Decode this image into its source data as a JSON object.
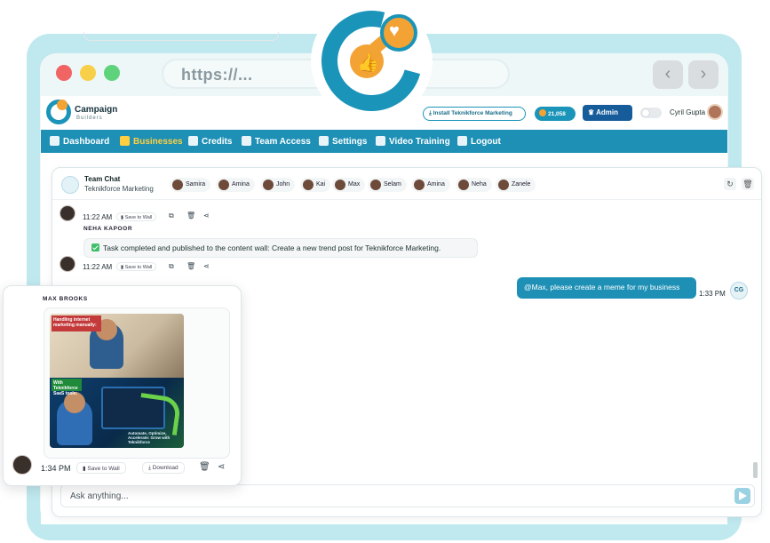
{
  "browser": {
    "url": "https://...",
    "back": "‹",
    "forward": "›"
  },
  "header": {
    "logo_line1": "Campaign",
    "logo_line2": "Builders",
    "install_label": "Install Teknikforce Marketing",
    "credits_value": "21,058",
    "admin_label": "Admin",
    "user_name": "Cyril Gupta"
  },
  "menu": [
    {
      "label": "Dashboard",
      "icon": "grid-icon"
    },
    {
      "label": "Businesses",
      "icon": "megaphone-icon",
      "active": true
    },
    {
      "label": "Credits",
      "icon": "coins-icon"
    },
    {
      "label": "Team Access",
      "icon": "team-icon"
    },
    {
      "label": "Settings",
      "icon": "gear-icon"
    },
    {
      "label": "Video Training",
      "icon": "video-icon"
    },
    {
      "label": "Logout",
      "icon": "logout-icon"
    }
  ],
  "chat": {
    "title": "Team Chat",
    "subtitle": "Teknikforce Marketing",
    "members": [
      "Samira",
      "Amina",
      "John",
      "Kai",
      "Max",
      "Selam",
      "Amina",
      "Neha",
      "Zanele"
    ],
    "msg1_time": "11:22 AM",
    "save_to_wall": "Save to Wall",
    "sender2": "NEHA KAPOOR",
    "msg2_text": "Task completed and published to the content wall: Create a new trend post for Teknikforce Marketing.",
    "msg2_time": "11:22 AM",
    "out_text": "@Max, please create a meme for my business",
    "out_time": "1:33 PM",
    "out_initials": "CG",
    "input_placeholder": "Ask anything..."
  },
  "float_card": {
    "sender": "MAX BROOKS",
    "meme_top_text": "Handling internet marketing manually:",
    "meme_bottom_text": "With Teknikforce SaaS tools:",
    "meme_caption": "Automate, Optimize, Accelerate: Grow with Teknikforce",
    "time": "1:34 PM",
    "save_label": "Save to Wall",
    "download_label": "Download"
  },
  "colors": {
    "brand": "#1e90b6",
    "accent": "#f3a234",
    "active_menu": "#ffcf3f"
  }
}
